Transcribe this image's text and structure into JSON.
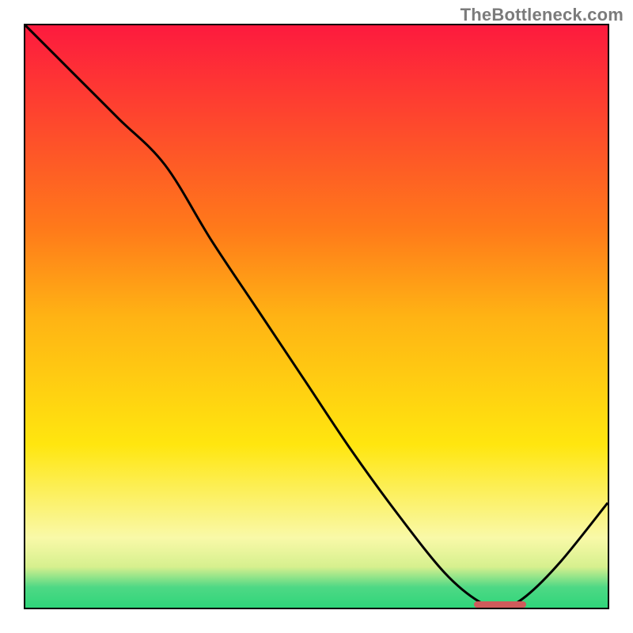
{
  "attribution": "TheBottleneck.com",
  "colors": {
    "frame": "#000000",
    "curve": "#000000",
    "red": "#fd1a3e",
    "orange": "#ff9316",
    "yellow": "#ffe60f",
    "pale_yellow": "#fcfcb3",
    "green": "#2fd67a",
    "optimum_marker": "#cf5b5b"
  },
  "chart_data": {
    "type": "line",
    "title": "",
    "xlabel": "",
    "ylabel": "",
    "xlim": [
      0,
      1
    ],
    "ylim": [
      0,
      1
    ],
    "x": [
      0.0,
      0.08,
      0.16,
      0.24,
      0.32,
      0.4,
      0.48,
      0.56,
      0.64,
      0.72,
      0.78,
      0.82,
      0.86,
      0.92,
      1.0
    ],
    "values": [
      1.0,
      0.92,
      0.84,
      0.76,
      0.63,
      0.51,
      0.39,
      0.27,
      0.16,
      0.06,
      0.01,
      0.0,
      0.02,
      0.08,
      0.18
    ],
    "gradient_stops": [
      {
        "pos": 0.0,
        "color": "#fd1a3e"
      },
      {
        "pos": 0.35,
        "color": "#ff7a1a"
      },
      {
        "pos": 0.5,
        "color": "#ffb314"
      },
      {
        "pos": 0.72,
        "color": "#ffe60f"
      },
      {
        "pos": 0.88,
        "color": "#f9f9a8"
      },
      {
        "pos": 0.93,
        "color": "#d6f08e"
      },
      {
        "pos": 0.965,
        "color": "#4ed885"
      },
      {
        "pos": 1.0,
        "color": "#2fd67a"
      }
    ],
    "optimum_marker": {
      "x_start": 0.77,
      "x_end": 0.86,
      "y": 0.005
    }
  }
}
